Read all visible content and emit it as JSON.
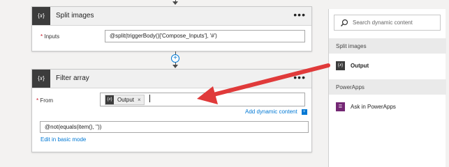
{
  "split_card": {
    "icon_text": "{𝑥}",
    "title": "Split images",
    "menu": "•••",
    "inputs_label": "Inputs",
    "required_mark": "*",
    "inputs_value": "@split(triggerBody()['Compose_Inputs'], '#')"
  },
  "connector": {
    "plus": "+"
  },
  "filter_card": {
    "icon_text": "{𝑥}",
    "title": "Filter array",
    "menu": "•••",
    "from_label": "From",
    "required_mark": "*",
    "token": {
      "icon_text": "{𝑥}",
      "label": "Output",
      "remove": "×"
    },
    "add_dynamic_content": "Add dynamic content",
    "add_dynamic_icon": "+",
    "expression_value": "@not(equals(item(), ''))",
    "edit_basic_mode": "Edit in basic mode"
  },
  "dynamic_panel": {
    "search_placeholder": "Search dynamic content",
    "sections": [
      {
        "title": "Split images",
        "items": [
          {
            "icon_text": "{𝑥}",
            "label": "Output"
          }
        ]
      },
      {
        "title": "PowerApps",
        "items": [
          {
            "icon_text": "☰",
            "label": "Ask in PowerApps"
          }
        ]
      }
    ]
  },
  "colors": {
    "accent": "#0078d4",
    "arrow": "#e03a3a",
    "action_icon": "#3c3c3c",
    "powerapps": "#742774"
  }
}
